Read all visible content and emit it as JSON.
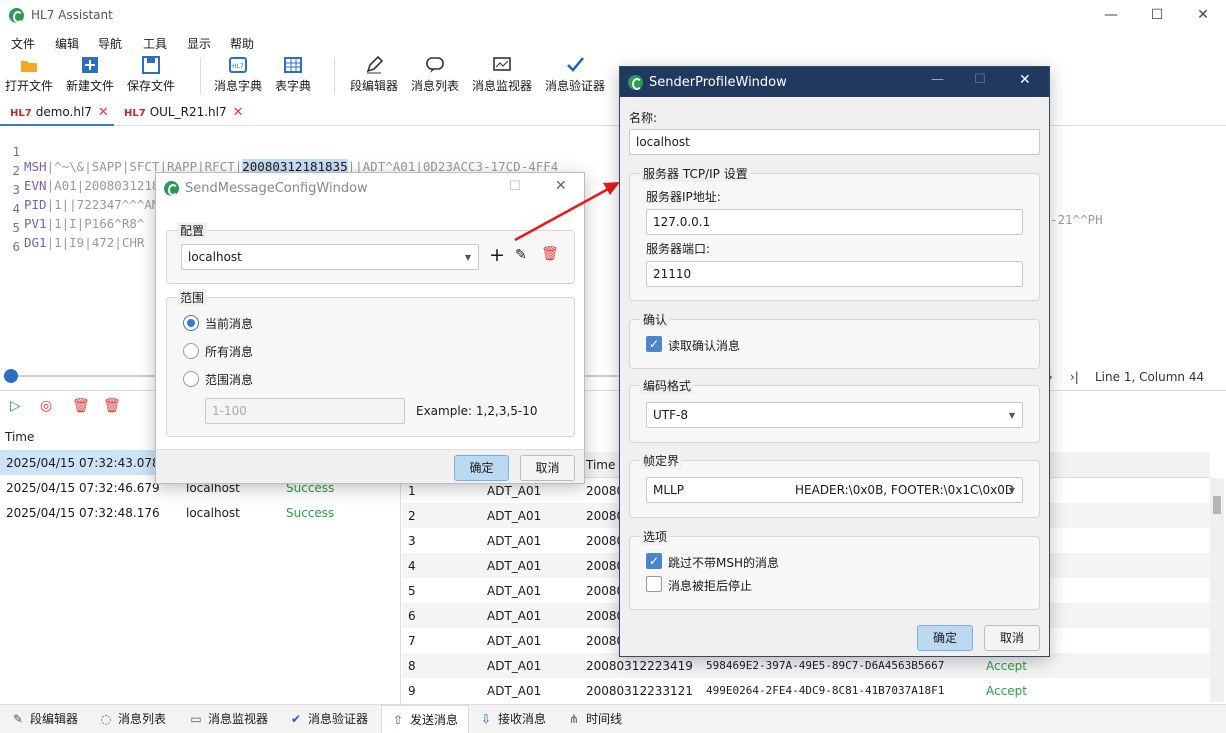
{
  "app": {
    "title": "HL7 Assistant"
  },
  "menu": [
    "文件",
    "编辑",
    "导航",
    "工具",
    "显示",
    "帮助"
  ],
  "toolbar": {
    "open": "打开文件",
    "new": "新建文件",
    "save": "保存文件",
    "msg_dict": "消息字典",
    "table_dict": "表字典",
    "seg_editor": "段编辑器",
    "msg_list": "消息列表",
    "msg_monitor": "消息监视器",
    "msg_validator": "消息验证器"
  },
  "tabs": [
    {
      "tag": "HL7",
      "label": "demo.hl7"
    },
    {
      "tag": "HL7",
      "label": "OUL_R21.hl7"
    }
  ],
  "editor": {
    "lines": [
      {
        "n": "1",
        "seg": "MSH",
        "pre": "|^~\\&|SAPP|SFCT|RAPP|RFCT|",
        "hl": "20080312181835",
        "post": "||ADT^A01|0D23ACC3-17CD-4FF4"
      },
      {
        "n": "2",
        "seg": "EVN",
        "pre": "|A01|20080312181835|",
        "hl": "",
        "post": ""
      },
      {
        "n": "3",
        "seg": "PID",
        "pre": "|1||722347^^^AMP||WILLIS^PATRICIA||19591001|F||HIGH STREET 21^^SAIN",
        "hl": "",
        "post": ""
      },
      {
        "n": "4",
        "seg": "PV1",
        "pre": "|1|I|P166^R8^",
        "hl": "",
        "post": ""
      },
      {
        "n": "5",
        "seg": "DG1",
        "pre": "|1|I9|472|CHR",
        "hl": "",
        "post": ""
      },
      {
        "n": "6",
        "seg": "",
        "pre": "",
        "hl": "",
        "post": ""
      }
    ],
    "right_fragment": "-21^^PH",
    "status": "Line 1, Column 44"
  },
  "sent": {
    "header_time": "Time",
    "rows": [
      {
        "time": "2025/04/15 07:32:43.078",
        "host": "localhost",
        "status": "Success"
      },
      {
        "time": "2025/04/15 07:32:46.679",
        "host": "localhost",
        "status": "Success"
      },
      {
        "time": "2025/04/15 07:32:48.176",
        "host": "localhost",
        "status": "Success"
      }
    ]
  },
  "messages": {
    "header_time": "Time",
    "rows": [
      {
        "n": "1",
        "type": "ADT_A01",
        "time": "20080",
        "id": "",
        "ack": ""
      },
      {
        "n": "2",
        "type": "ADT_A01",
        "time": "20080",
        "id": "",
        "ack": ""
      },
      {
        "n": "3",
        "type": "ADT_A01",
        "time": "20080",
        "id": "",
        "ack": ""
      },
      {
        "n": "4",
        "type": "ADT_A01",
        "time": "20080",
        "id": "",
        "ack": ""
      },
      {
        "n": "5",
        "type": "ADT_A01",
        "time": "20080",
        "id": "",
        "ack": ""
      },
      {
        "n": "6",
        "type": "ADT_A01",
        "time": "20080",
        "id": "",
        "ack": ""
      },
      {
        "n": "7",
        "type": "ADT_A01",
        "time": "20080",
        "id": "",
        "ack": ""
      },
      {
        "n": "8",
        "type": "ADT_A01",
        "time": "20080312223419",
        "id": "598469E2-397A-49E5-89C7-D6A4563B5667",
        "ack": "Accept"
      },
      {
        "n": "9",
        "type": "ADT_A01",
        "time": "20080312233121",
        "id": "499E0264-2FE4-4DC9-8C81-41B7037A18F1",
        "ack": "Accept"
      }
    ]
  },
  "bottom_tabs": [
    "段编辑器",
    "消息列表",
    "消息监视器",
    "消息验证器",
    "发送消息",
    "接收消息",
    "时间线"
  ],
  "send_config": {
    "title": "SendMessageConfigWindow",
    "config_label": "配置",
    "profile": "localhost",
    "range_label": "范围",
    "opt_current": "当前消息",
    "opt_all": "所有消息",
    "opt_range": "范围消息",
    "range_placeholder": "1-100",
    "example": "Example: 1,2,3,5-10",
    "ok": "确定",
    "cancel": "取消"
  },
  "profile": {
    "title": "SenderProfileWindow",
    "name_label": "名称:",
    "name_value": "localhost",
    "tcp_group": "服务器 TCP/IP 设置",
    "ip_label": "服务器IP地址:",
    "ip_value": "127.0.0.1",
    "port_label": "服务器端口:",
    "port_value": "21110",
    "ack_group": "确认",
    "ack_check": "读取确认消息",
    "enc_group": "编码格式",
    "enc_value": "UTF-8",
    "frame_group": "帧定界",
    "frame_value": "MLLP",
    "frame_detail": "HEADER:\\0x0B, FOOTER:\\0x1C\\0x0D",
    "opt_group": "选项",
    "skip_check": "跳过不带MSH的消息",
    "stop_check": "消息被拒后停止",
    "ok": "确定",
    "cancel": "取消"
  }
}
